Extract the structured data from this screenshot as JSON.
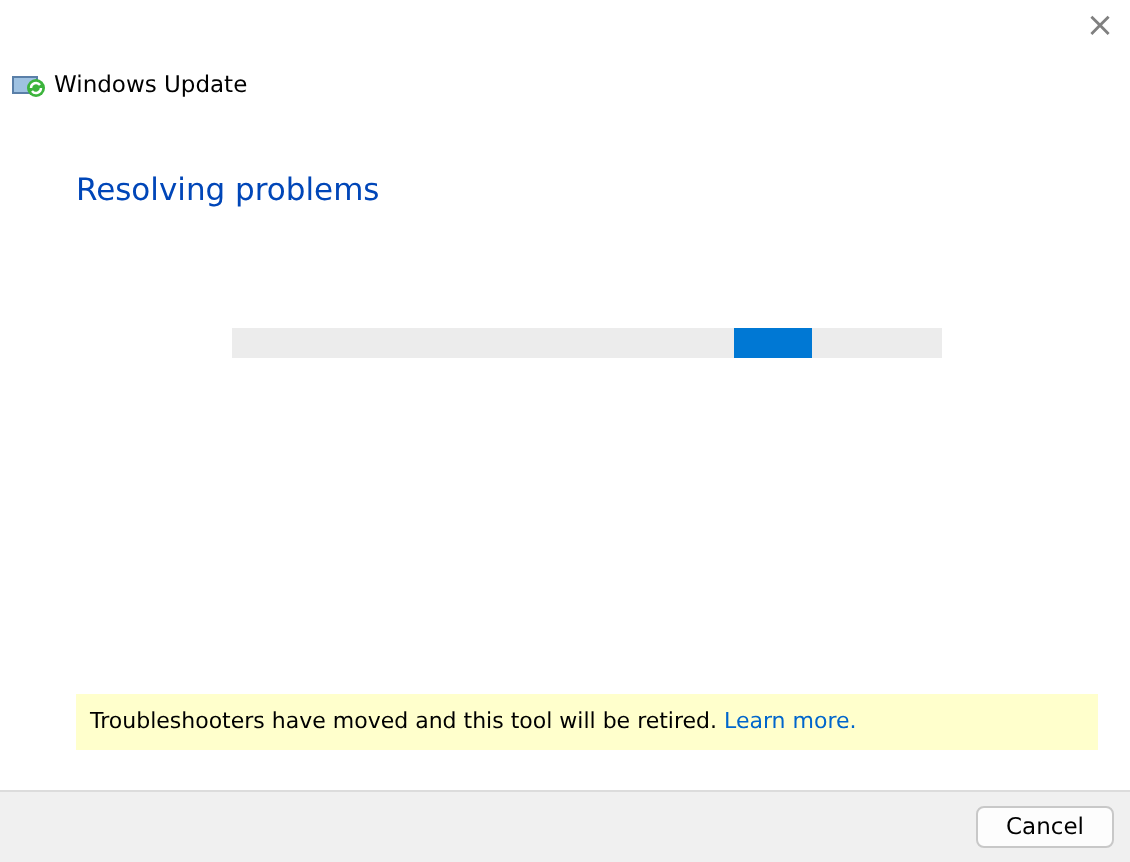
{
  "window": {
    "close": "×"
  },
  "header": {
    "title": "Windows Update"
  },
  "heading": "Resolving problems",
  "progress": {
    "kind": "indeterminate"
  },
  "notice": {
    "text": "Troubleshooters have moved and this tool will be retired.",
    "link": "Learn more."
  },
  "buttons": [
    "Cancel"
  ]
}
